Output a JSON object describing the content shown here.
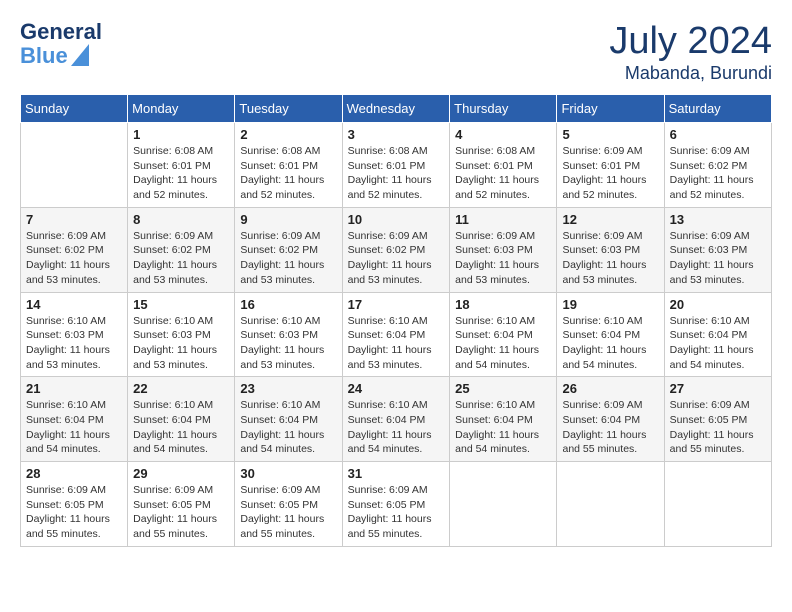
{
  "logo": {
    "text_general": "General",
    "text_blue": "Blue"
  },
  "title": {
    "month_year": "July 2024",
    "location": "Mabanda, Burundi"
  },
  "days_of_week": [
    "Sunday",
    "Monday",
    "Tuesday",
    "Wednesday",
    "Thursday",
    "Friday",
    "Saturday"
  ],
  "weeks": [
    [
      {
        "day": "",
        "info": ""
      },
      {
        "day": "1",
        "info": "Sunrise: 6:08 AM\nSunset: 6:01 PM\nDaylight: 11 hours\nand 52 minutes."
      },
      {
        "day": "2",
        "info": "Sunrise: 6:08 AM\nSunset: 6:01 PM\nDaylight: 11 hours\nand 52 minutes."
      },
      {
        "day": "3",
        "info": "Sunrise: 6:08 AM\nSunset: 6:01 PM\nDaylight: 11 hours\nand 52 minutes."
      },
      {
        "day": "4",
        "info": "Sunrise: 6:08 AM\nSunset: 6:01 PM\nDaylight: 11 hours\nand 52 minutes."
      },
      {
        "day": "5",
        "info": "Sunrise: 6:09 AM\nSunset: 6:01 PM\nDaylight: 11 hours\nand 52 minutes."
      },
      {
        "day": "6",
        "info": "Sunrise: 6:09 AM\nSunset: 6:02 PM\nDaylight: 11 hours\nand 52 minutes."
      }
    ],
    [
      {
        "day": "7",
        "info": "Sunrise: 6:09 AM\nSunset: 6:02 PM\nDaylight: 11 hours\nand 53 minutes."
      },
      {
        "day": "8",
        "info": "Sunrise: 6:09 AM\nSunset: 6:02 PM\nDaylight: 11 hours\nand 53 minutes."
      },
      {
        "day": "9",
        "info": "Sunrise: 6:09 AM\nSunset: 6:02 PM\nDaylight: 11 hours\nand 53 minutes."
      },
      {
        "day": "10",
        "info": "Sunrise: 6:09 AM\nSunset: 6:02 PM\nDaylight: 11 hours\nand 53 minutes."
      },
      {
        "day": "11",
        "info": "Sunrise: 6:09 AM\nSunset: 6:03 PM\nDaylight: 11 hours\nand 53 minutes."
      },
      {
        "day": "12",
        "info": "Sunrise: 6:09 AM\nSunset: 6:03 PM\nDaylight: 11 hours\nand 53 minutes."
      },
      {
        "day": "13",
        "info": "Sunrise: 6:09 AM\nSunset: 6:03 PM\nDaylight: 11 hours\nand 53 minutes."
      }
    ],
    [
      {
        "day": "14",
        "info": "Sunrise: 6:10 AM\nSunset: 6:03 PM\nDaylight: 11 hours\nand 53 minutes."
      },
      {
        "day": "15",
        "info": "Sunrise: 6:10 AM\nSunset: 6:03 PM\nDaylight: 11 hours\nand 53 minutes."
      },
      {
        "day": "16",
        "info": "Sunrise: 6:10 AM\nSunset: 6:03 PM\nDaylight: 11 hours\nand 53 minutes."
      },
      {
        "day": "17",
        "info": "Sunrise: 6:10 AM\nSunset: 6:04 PM\nDaylight: 11 hours\nand 53 minutes."
      },
      {
        "day": "18",
        "info": "Sunrise: 6:10 AM\nSunset: 6:04 PM\nDaylight: 11 hours\nand 54 minutes."
      },
      {
        "day": "19",
        "info": "Sunrise: 6:10 AM\nSunset: 6:04 PM\nDaylight: 11 hours\nand 54 minutes."
      },
      {
        "day": "20",
        "info": "Sunrise: 6:10 AM\nSunset: 6:04 PM\nDaylight: 11 hours\nand 54 minutes."
      }
    ],
    [
      {
        "day": "21",
        "info": "Sunrise: 6:10 AM\nSunset: 6:04 PM\nDaylight: 11 hours\nand 54 minutes."
      },
      {
        "day": "22",
        "info": "Sunrise: 6:10 AM\nSunset: 6:04 PM\nDaylight: 11 hours\nand 54 minutes."
      },
      {
        "day": "23",
        "info": "Sunrise: 6:10 AM\nSunset: 6:04 PM\nDaylight: 11 hours\nand 54 minutes."
      },
      {
        "day": "24",
        "info": "Sunrise: 6:10 AM\nSunset: 6:04 PM\nDaylight: 11 hours\nand 54 minutes."
      },
      {
        "day": "25",
        "info": "Sunrise: 6:10 AM\nSunset: 6:04 PM\nDaylight: 11 hours\nand 54 minutes."
      },
      {
        "day": "26",
        "info": "Sunrise: 6:09 AM\nSunset: 6:04 PM\nDaylight: 11 hours\nand 55 minutes."
      },
      {
        "day": "27",
        "info": "Sunrise: 6:09 AM\nSunset: 6:05 PM\nDaylight: 11 hours\nand 55 minutes."
      }
    ],
    [
      {
        "day": "28",
        "info": "Sunrise: 6:09 AM\nSunset: 6:05 PM\nDaylight: 11 hours\nand 55 minutes."
      },
      {
        "day": "29",
        "info": "Sunrise: 6:09 AM\nSunset: 6:05 PM\nDaylight: 11 hours\nand 55 minutes."
      },
      {
        "day": "30",
        "info": "Sunrise: 6:09 AM\nSunset: 6:05 PM\nDaylight: 11 hours\nand 55 minutes."
      },
      {
        "day": "31",
        "info": "Sunrise: 6:09 AM\nSunset: 6:05 PM\nDaylight: 11 hours\nand 55 minutes."
      },
      {
        "day": "",
        "info": ""
      },
      {
        "day": "",
        "info": ""
      },
      {
        "day": "",
        "info": ""
      }
    ]
  ]
}
